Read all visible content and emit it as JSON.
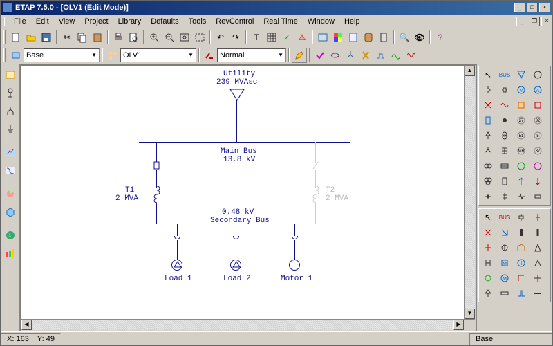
{
  "title": "ETAP 7.5.0 - [OLV1 (Edit Mode)]",
  "menu": [
    "File",
    "Edit",
    "View",
    "Project",
    "Library",
    "Defaults",
    "Tools",
    "RevControl",
    "Real Time",
    "Window",
    "Help"
  ],
  "toolbar2": {
    "combo1": "Base",
    "combo2": "OLV1",
    "combo3": "Normal"
  },
  "status": {
    "x_label": "X:",
    "x_val": "163",
    "y_label": "Y:",
    "y_val": "49",
    "mode": "Base"
  },
  "diagram": {
    "utility": "Utility",
    "utility_val": "239 MVAsc",
    "main_bus": "Main Bus",
    "main_kv": "13.8 kV",
    "t1": "T1",
    "t1_val": "2 MVA",
    "t2": "T2",
    "t2_val": "2 MVA",
    "sec_kv": "0.48 kV",
    "sec_bus": "Secondary Bus",
    "load1": "Load 1",
    "load2": "Load 2",
    "motor1": "Motor 1"
  }
}
